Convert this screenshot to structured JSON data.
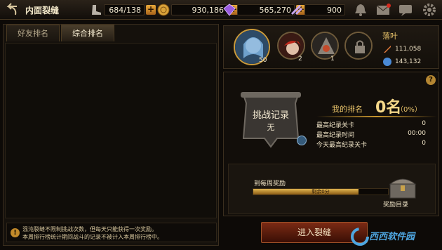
{
  "header": {
    "title": "内面裂缝",
    "stamina": "684/138",
    "gold": "930,186",
    "gems": "565,270",
    "tickets": "900"
  },
  "tabs": [
    "好友排名",
    "综合排名"
  ],
  "notice": {
    "line1": "混沌裂缝不限制挑战次数，但每天只能获得一次奖励。",
    "line2": "本周排行榜统计期间战斗的记录不被计入本周排行榜中。"
  },
  "team": {
    "main_level": "50",
    "hero2_level": "2",
    "hero3_level": "1",
    "player_name": "落叶",
    "stat1": "111,058",
    "stat2": "143,132"
  },
  "record": {
    "title": "挑战记录",
    "value": "无",
    "my_rank_label": "我的排名",
    "my_rank_value": "0名",
    "my_rank_pct": "（0%）",
    "rows": [
      {
        "label": "最高纪录关卡",
        "value": "0"
      },
      {
        "label": "最高纪录时间",
        "value": "00:00"
      },
      {
        "label": "今天最高纪录关卡",
        "value": "0"
      }
    ]
  },
  "weekly": {
    "label": "到每周奖励",
    "bar_text": "剩余0分",
    "progress": 0.78,
    "chest_label": "奖励目录"
  },
  "enter_button": "进入裂缝",
  "watermark": "西西软件园"
}
